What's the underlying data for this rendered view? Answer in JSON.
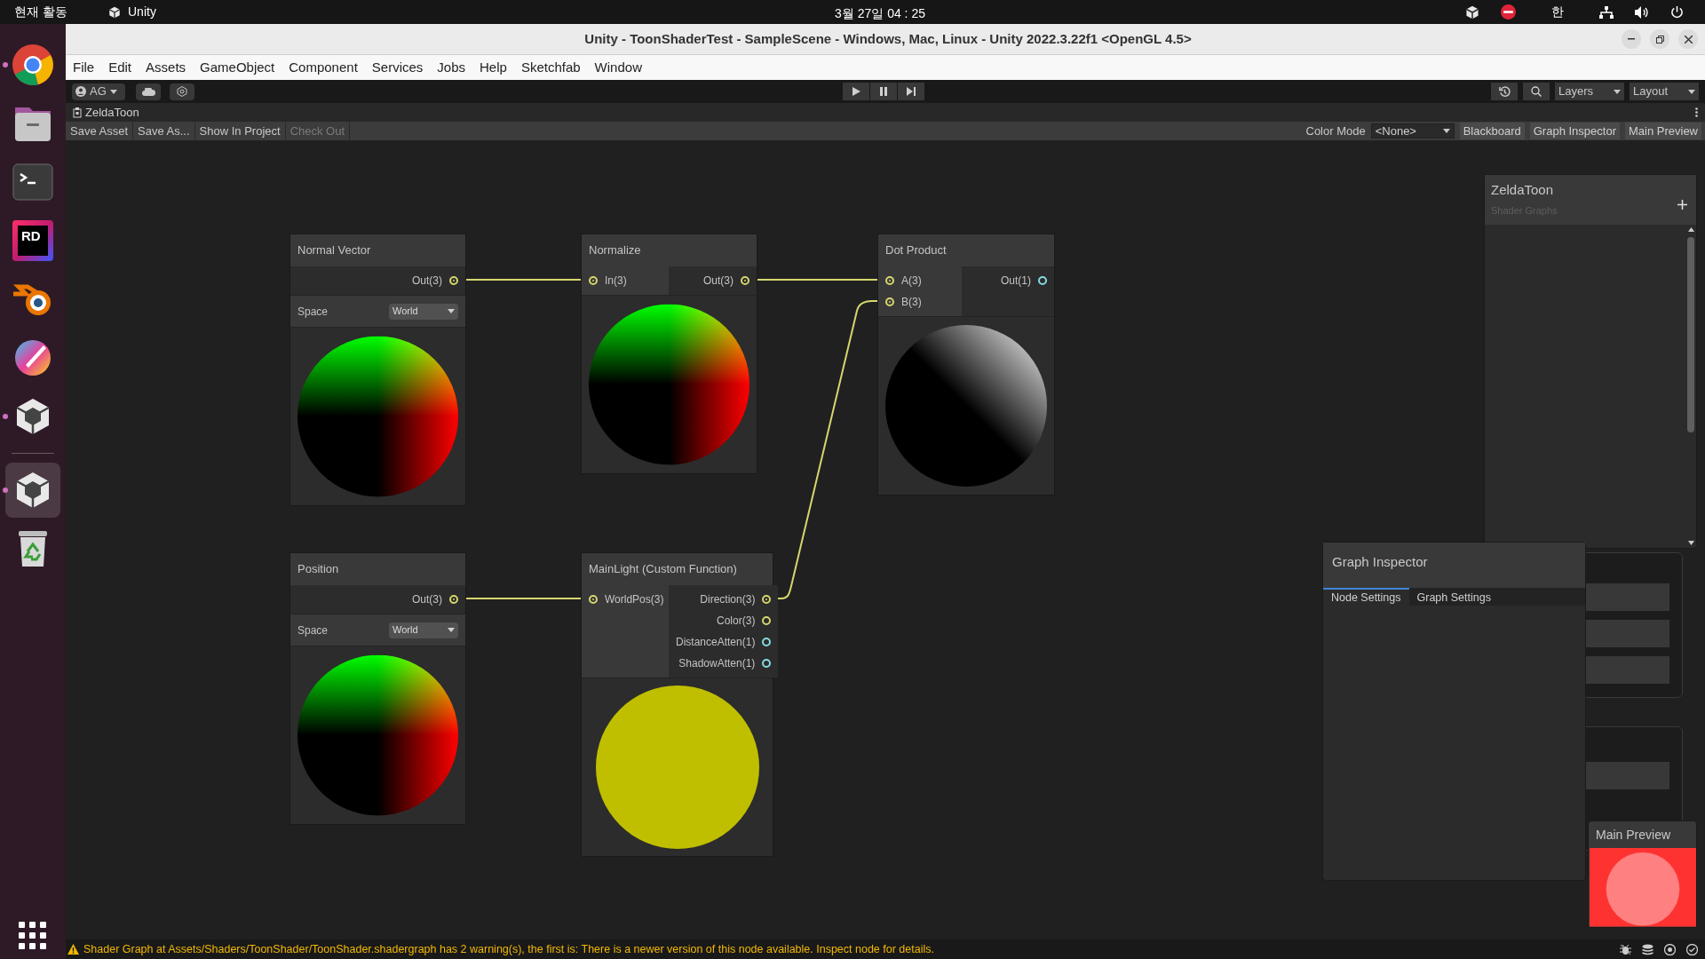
{
  "top_bar": {
    "activities": "현재 활동",
    "app_name": "Unity",
    "clock": "3월 27일 04 : 25",
    "input_method": "한"
  },
  "dock": [
    {
      "kind": "browser",
      "running": true
    },
    {
      "kind": "files",
      "running": false
    },
    {
      "kind": "terminal",
      "running": false
    },
    {
      "kind": "ide",
      "text": "RD",
      "running": false
    },
    {
      "kind": "blender",
      "running": false
    },
    {
      "kind": "paint",
      "running": false
    },
    {
      "kind": "hub",
      "running": true
    },
    {
      "kind": "unity",
      "running": true,
      "selected": true
    },
    {
      "kind": "trash",
      "running": false
    }
  ],
  "window": {
    "title": "Unity - ToonShaderTest - SampleScene - Windows, Mac, Linux - Unity 2022.3.22f1 <OpenGL 4.5>"
  },
  "menu": [
    "File",
    "Edit",
    "Assets",
    "GameObject",
    "Component",
    "Services",
    "Jobs",
    "Help",
    "Sketchfab",
    "Window"
  ],
  "toolbar": {
    "account": "AG",
    "layers": "Layers",
    "layout": "Layout"
  },
  "editor_tab": {
    "title": "ZeldaToon"
  },
  "graph_toolbar": {
    "buttons": [
      {
        "label": "Save Asset",
        "disabled": false
      },
      {
        "label": "Save As...",
        "disabled": false
      },
      {
        "label": "Show In Project",
        "disabled": false
      },
      {
        "label": "Check Out",
        "disabled": true
      }
    ],
    "color_mode": {
      "label": "Color Mode",
      "value": "<None>"
    },
    "toggles": [
      "Blackboard",
      "Graph Inspector",
      "Main Preview"
    ]
  },
  "nodes": [
    {
      "title": "Normal Vector",
      "outputs": [
        {
          "label": "Out(3)",
          "connected": true,
          "color": "#d6d66e"
        }
      ],
      "space": {
        "label": "Space",
        "value": "World"
      },
      "kind": "normals"
    },
    {
      "title": "Normalize",
      "inputs": [
        {
          "label": "In(3)",
          "connected": true,
          "color": "#d6d66e"
        }
      ],
      "outputs": [
        {
          "label": "Out(3)",
          "connected": true,
          "color": "#d6d66e"
        }
      ],
      "kind": "normals"
    },
    {
      "title": "Dot Product",
      "inputs": [
        {
          "label": "A(3)",
          "connected": true,
          "color": "#d6d66e"
        },
        {
          "label": "B(3)",
          "connected": true,
          "color": "#d6d66e"
        }
      ],
      "outputs": [
        {
          "label": "Out(1)",
          "connected": false,
          "color": "#84dde0"
        }
      ],
      "kind": "gradient"
    },
    {
      "title": "Position",
      "outputs": [
        {
          "label": "Out(3)",
          "connected": true,
          "color": "#d6d66e"
        }
      ],
      "space": {
        "label": "Space",
        "value": "World"
      },
      "kind": "normals"
    },
    {
      "title": "MainLight (Custom Function)",
      "inputs": [
        {
          "label": "WorldPos(3)",
          "connected": true,
          "color": "#d6d66e"
        }
      ],
      "outputs": [
        {
          "label": "Direction(3)",
          "connected": true,
          "color": "#d6d66e"
        },
        {
          "label": "Color(3)",
          "connected": false,
          "color": "#d6d66e"
        },
        {
          "label": "DistanceAtten(1)",
          "connected": false,
          "color": "#84dde0"
        },
        {
          "label": "ShadowAtten(1)",
          "connected": false,
          "color": "#84dde0"
        }
      ],
      "kind": "solid"
    }
  ],
  "blackboard": {
    "title": "ZeldaToon",
    "subtitle": "Shader Graphs"
  },
  "graph_inspector": {
    "title": "Graph Inspector",
    "tabs": [
      {
        "label": "Node Settings",
        "selected": true
      },
      {
        "label": "Graph Settings",
        "selected": false
      }
    ]
  },
  "main_preview": {
    "title": "Main Preview"
  },
  "status_bar": {
    "message": "Shader Graph at Assets/Shaders/ToonShader/ToonShader.shadergraph has 2 warning(s), the first is: There is a newer version of this node available. Inspect node for details."
  }
}
